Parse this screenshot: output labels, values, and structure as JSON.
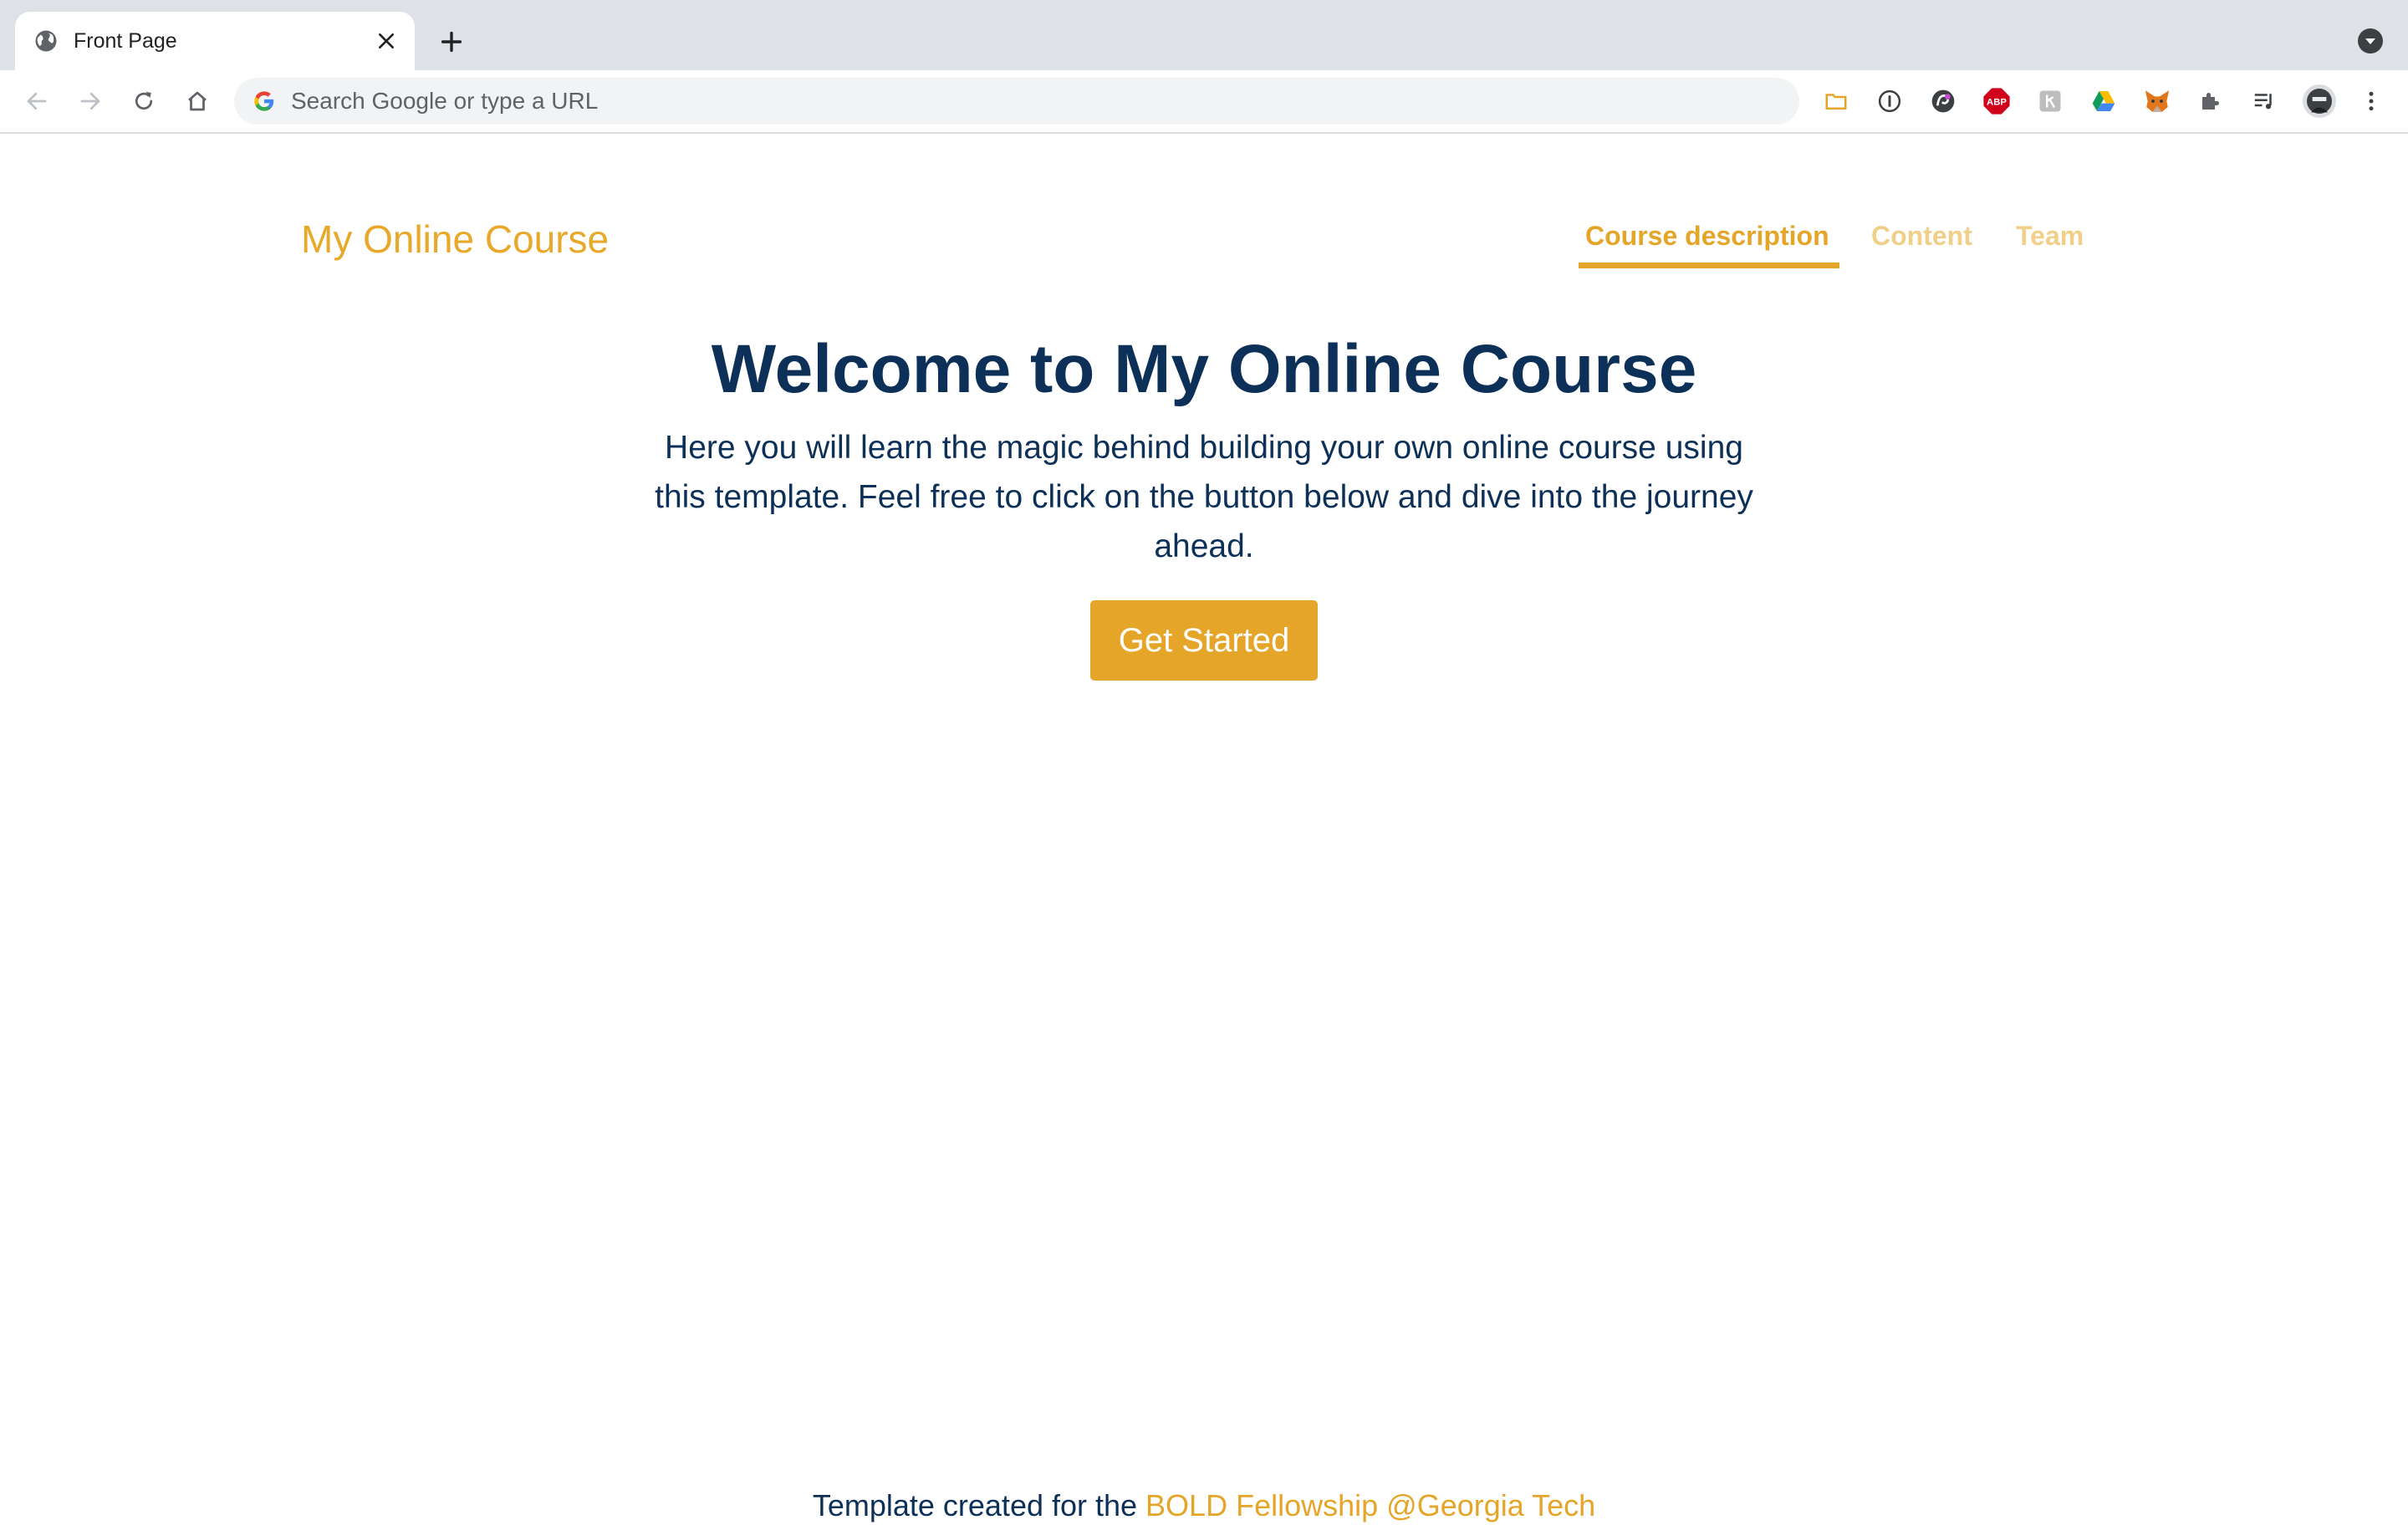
{
  "browser": {
    "tab": {
      "title": "Front Page"
    },
    "omnibox": {
      "placeholder": "Search Google or type a URL",
      "value": ""
    },
    "extensions": [
      {
        "name": "folder-icon"
      },
      {
        "name": "1password-icon"
      },
      {
        "name": "extension-swirl-icon"
      },
      {
        "name": "adblock-plus-icon",
        "label": "ABP"
      },
      {
        "name": "extension-gray-icon"
      },
      {
        "name": "google-drive-icon"
      },
      {
        "name": "metamask-icon"
      },
      {
        "name": "puzzle-icon"
      },
      {
        "name": "media-queue-icon"
      },
      {
        "name": "profile-avatar"
      },
      {
        "name": "menu-icon"
      }
    ]
  },
  "page": {
    "site_title": "My Online Course",
    "nav": [
      {
        "label": "Course description",
        "active": true
      },
      {
        "label": "Content",
        "active": false
      },
      {
        "label": "Team",
        "active": false
      }
    ],
    "hero": {
      "title": "Welcome to My Online Course",
      "text": "Here you will learn the magic behind building your own online course using this template. Feel free to click on the button below and dive into the journey ahead.",
      "button_label": "Get Started"
    },
    "footer": {
      "prefix": "Template created for the ",
      "link_text": "BOLD Fellowship @Georgia Tech"
    }
  },
  "colors": {
    "accent": "#e5a528",
    "accent_light": "#f0cf88",
    "heading": "#0c3057"
  }
}
